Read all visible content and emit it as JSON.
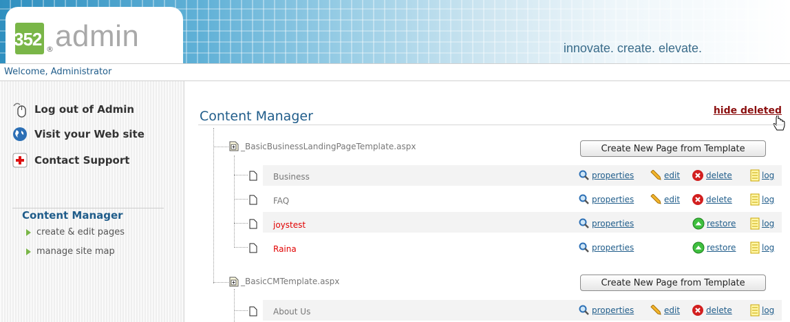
{
  "header": {
    "logo_number": "352",
    "logo_registered": "®",
    "logo_text": "admin",
    "tagline": "innovate. create. elevate."
  },
  "welcome_text": "Welcome, Administrator",
  "sidebar": {
    "links": [
      {
        "label": "Log out of Admin",
        "icon": "mouse-icon"
      },
      {
        "label": "Visit your Web site",
        "icon": "globe-icon"
      },
      {
        "label": "Contact Support",
        "icon": "first-aid-icon"
      }
    ],
    "section_title": "Content Manager",
    "sub_links": [
      {
        "label": "create & edit pages"
      },
      {
        "label": "manage site map"
      }
    ]
  },
  "main": {
    "title": "Content Manager",
    "hide_deleted": "hide deleted",
    "create_button_label": "Create New Page from Template",
    "actions": {
      "properties": "properties",
      "edit": "edit",
      "delete": "delete",
      "restore": "restore",
      "log": "log"
    },
    "templates": [
      {
        "name": "_BasicBusinessLandingPageTemplate.aspx",
        "pages": [
          {
            "name": "Business",
            "deleted": false
          },
          {
            "name": "FAQ",
            "deleted": false
          },
          {
            "name": "joystest",
            "deleted": true
          },
          {
            "name": "Raina",
            "deleted": true
          }
        ]
      },
      {
        "name": "_BasicCMTemplate.aspx",
        "pages": [
          {
            "name": "About Us",
            "deleted": false
          }
        ]
      }
    ]
  },
  "colors": {
    "accent_blue": "#1f5c8a",
    "deleted_red": "#e10000",
    "hide_link": "#8b0f0f",
    "logo_green": "#7ab648"
  }
}
